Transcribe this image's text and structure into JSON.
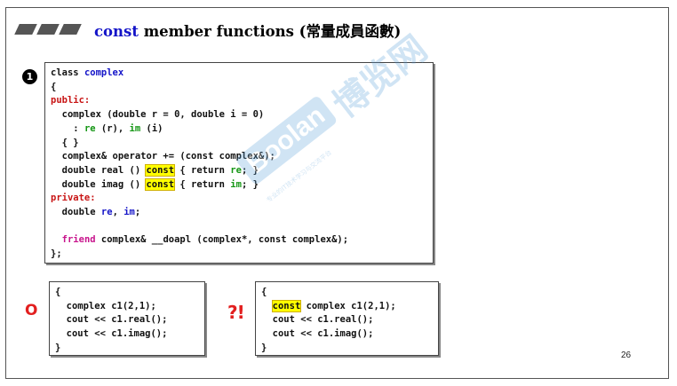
{
  "slide": {
    "title_keyword": "const",
    "title_text": " member functions (常量成員函數)",
    "badge": "1",
    "mark_ok": "O",
    "mark_question": "?!",
    "page_number": "26"
  },
  "code_main": [
    [
      [
        "plain",
        "class "
      ],
      [
        "kw",
        "complex"
      ]
    ],
    [
      [
        "plain",
        "{"
      ]
    ],
    [
      [
        "red",
        "public:"
      ]
    ],
    [
      [
        "plain",
        "  complex (double r = 0, double i = 0)"
      ]
    ],
    [
      [
        "plain",
        "    : "
      ],
      [
        "grn",
        "re"
      ],
      [
        "plain",
        " (r), "
      ],
      [
        "grn",
        "im"
      ],
      [
        "plain",
        " (i)"
      ]
    ],
    [
      [
        "plain",
        "  { }"
      ]
    ],
    [
      [
        "plain",
        "  complex& operator += (const complex&);"
      ]
    ],
    [
      [
        "plain",
        "  double real () "
      ],
      [
        "hl",
        "const"
      ],
      [
        "plain",
        " { return "
      ],
      [
        "grn",
        "re"
      ],
      [
        "plain",
        "; }"
      ]
    ],
    [
      [
        "plain",
        "  double imag () "
      ],
      [
        "hl",
        "const"
      ],
      [
        "plain",
        " { return "
      ],
      [
        "grn",
        "im"
      ],
      [
        "plain",
        "; }"
      ]
    ],
    [
      [
        "red",
        "private:"
      ]
    ],
    [
      [
        "plain",
        "  double "
      ],
      [
        "kw",
        "re"
      ],
      [
        "plain",
        ", "
      ],
      [
        "kw",
        "im"
      ],
      [
        "plain",
        ";"
      ]
    ],
    [
      [
        "plain",
        ""
      ]
    ],
    [
      [
        "plain",
        "  "
      ],
      [
        "mag",
        "friend"
      ],
      [
        "plain",
        " complex& __doapl (complex*, const complex&);"
      ]
    ],
    [
      [
        "plain",
        "};"
      ]
    ]
  ],
  "code_small1": [
    [
      [
        "plain",
        "{"
      ]
    ],
    [
      [
        "plain",
        "  complex c1(2,1);"
      ]
    ],
    [
      [
        "plain",
        "  cout << c1.real();"
      ]
    ],
    [
      [
        "plain",
        "  cout << c1.imag();"
      ]
    ],
    [
      [
        "plain",
        "}"
      ]
    ]
  ],
  "code_small2": [
    [
      [
        "plain",
        "{"
      ]
    ],
    [
      [
        "plain",
        "  "
      ],
      [
        "hl",
        "const"
      ],
      [
        "plain",
        " complex c1(2,1);"
      ]
    ],
    [
      [
        "plain",
        "  cout << c1.real();"
      ]
    ],
    [
      [
        "plain",
        "  cout << c1.imag();"
      ]
    ],
    [
      [
        "plain",
        "}"
      ]
    ]
  ],
  "watermark": {
    "logo": "Boolan",
    "text": "博览网",
    "sub": "专业的IT技术学习与交流平台"
  },
  "colors": {
    "keyword": "#1414c8",
    "access": "#c81414",
    "member": "#149614",
    "friend": "#c8148c",
    "highlight": "#ffff00"
  }
}
